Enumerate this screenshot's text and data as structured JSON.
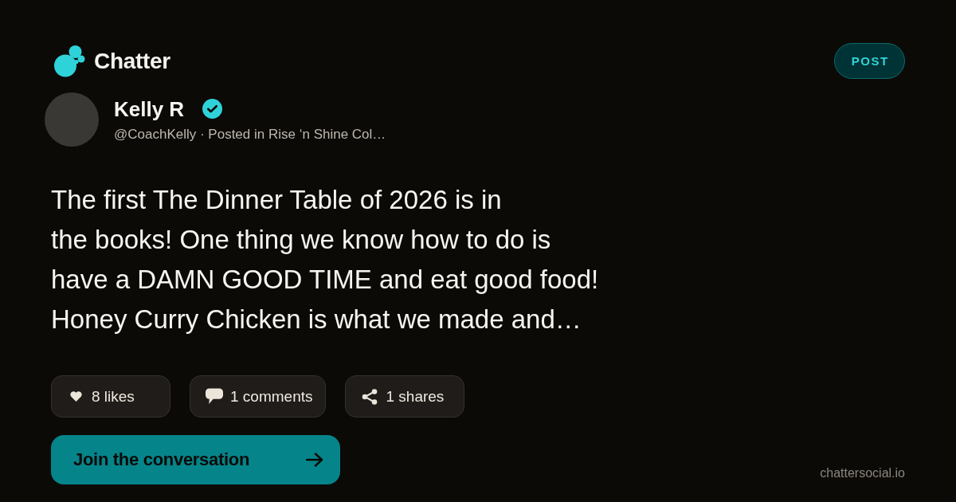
{
  "brand": {
    "name": "Chatter"
  },
  "post_button": {
    "label": "POST"
  },
  "author": {
    "name": "Kelly R",
    "verified": true,
    "byline": "@CoachKelly · Posted in Rise ‘n Shine Col…"
  },
  "body": {
    "text": "The first The Dinner Table of 2026 is in\nthe books! One thing we know how to do is\nhave a DAMN GOOD TIME and eat good food!\nHoney Curry Chicken is what we made and…"
  },
  "stats": [
    {
      "kind": "likes",
      "label": "8 likes"
    },
    {
      "kind": "comments",
      "label": "1 comments"
    },
    {
      "kind": "shares",
      "label": "1 shares"
    }
  ],
  "cta": {
    "label": "Join the conversation"
  },
  "footer": {
    "site": "chattersocial.io"
  }
}
